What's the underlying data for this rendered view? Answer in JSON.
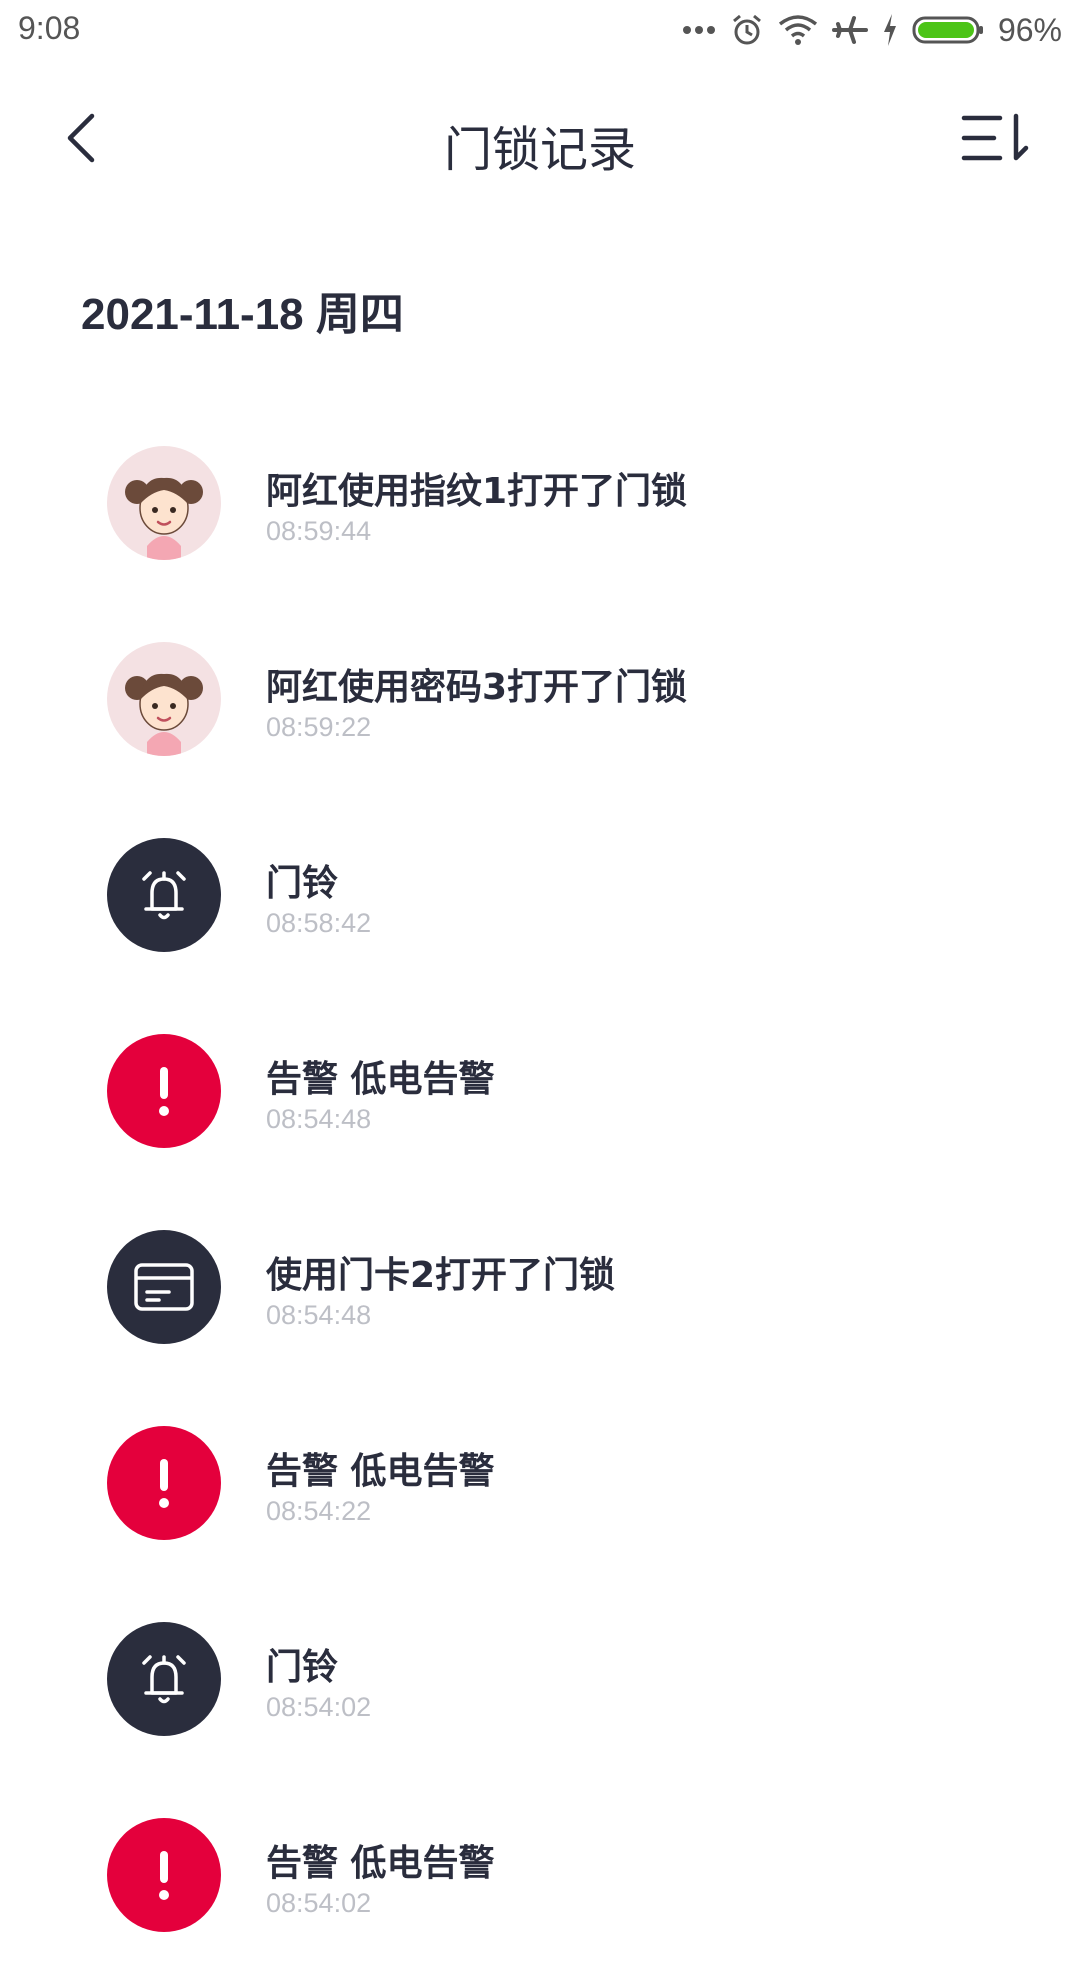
{
  "status_bar": {
    "time": "9:08",
    "battery": "96%",
    "icons": [
      "more-dots-icon",
      "alarm-icon",
      "wifi-icon",
      "airplane-icon",
      "charging-icon",
      "battery-icon"
    ]
  },
  "header": {
    "title": "门锁记录",
    "back_icon": "chevron-left-icon",
    "filter_icon": "sort-filter-icon"
  },
  "date_heading": "2021-11-18 周四",
  "records": [
    {
      "icon": "girl-avatar",
      "title": "阿红使用指纹1打开了门锁",
      "time": "08:59:44"
    },
    {
      "icon": "girl-avatar",
      "title": "阿红使用密码3打开了门锁",
      "time": "08:59:22"
    },
    {
      "icon": "bell-icon",
      "title": "门铃",
      "time": "08:58:42"
    },
    {
      "icon": "alert-icon",
      "title": "告警 低电告警",
      "time": "08:54:48"
    },
    {
      "icon": "card-icon",
      "title": "使用门卡2打开了门锁",
      "time": "08:54:48"
    },
    {
      "icon": "alert-icon",
      "title": "告警 低电告警",
      "time": "08:54:22"
    },
    {
      "icon": "bell-icon",
      "title": "门铃",
      "time": "08:54:02"
    },
    {
      "icon": "alert-icon",
      "title": "告警 低电告警",
      "time": "08:54:02"
    }
  ],
  "colors": {
    "dark": "#2a2d3d",
    "alert": "#e4003c",
    "time_gray": "#bdbfc6",
    "battery_green": "#4cc417"
  }
}
